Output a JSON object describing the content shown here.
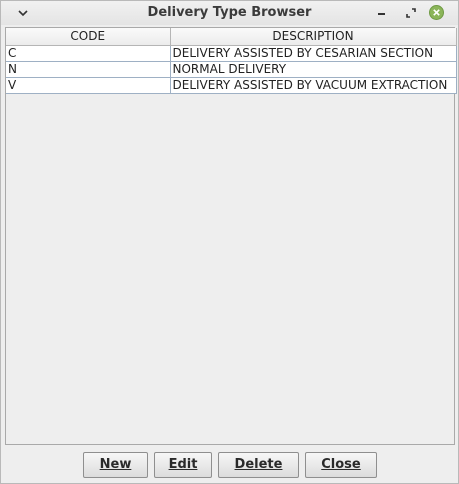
{
  "window": {
    "title": "Delivery Type Browser",
    "close_color": "#8bb559"
  },
  "titlebar_icons": [
    "window-menu-icon",
    "minimize-icon",
    "maximize-icon",
    "close-icon"
  ],
  "table": {
    "headers": [
      "CODE",
      "DESCRIPTION"
    ],
    "rows": [
      [
        "C",
        "DELIVERY ASSISTED BY CESARIAN SECTION"
      ],
      [
        "N",
        "NORMAL DELIVERY"
      ],
      [
        "V",
        "DELIVERY ASSISTED BY VACUUM EXTRACTION"
      ]
    ]
  },
  "buttons": {
    "new_label": "New",
    "edit_label": "Edit",
    "delete_label": "Delete",
    "close_label": "Close"
  }
}
